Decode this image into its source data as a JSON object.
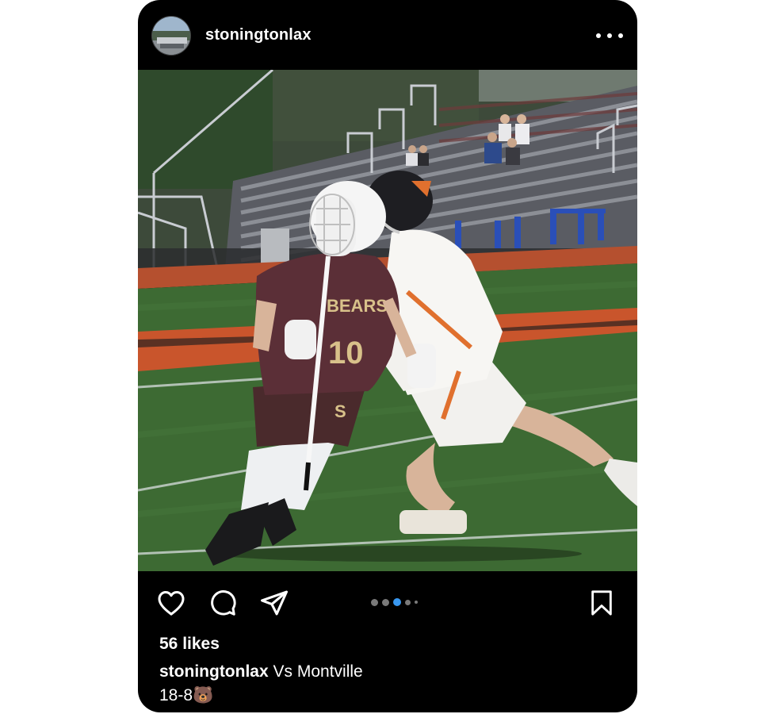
{
  "post": {
    "username": "stoningtonlax",
    "likes_text": "56 likes",
    "caption_user": "stoningtonlax",
    "caption_text": "Vs Montville",
    "caption_line2": "18-8",
    "caption_emoji": "🐻",
    "image_alt": "Two lacrosse players: Bears #10 in maroon jersey running with stick, defender in white and orange uniform",
    "jersey_text": "BEARS",
    "jersey_number": "10",
    "carousel": {
      "count": 5,
      "active_index": 2
    }
  },
  "icons": {
    "like": "heart-icon",
    "comment": "comment-icon",
    "share": "share-icon",
    "save": "bookmark-icon",
    "more": "more-options-icon"
  },
  "colors": {
    "background": "#000000",
    "text": "#ffffff",
    "carousel_active": "#3897f0",
    "carousel_inactive": "#7a7a7a"
  }
}
